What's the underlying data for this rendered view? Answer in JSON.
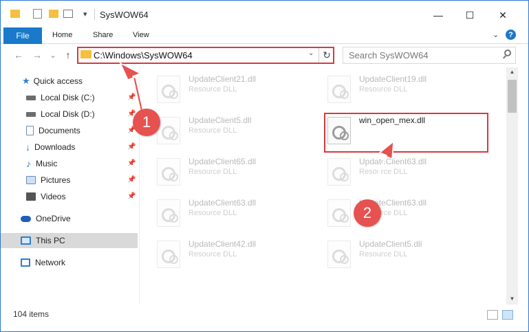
{
  "window": {
    "title": "SysWOW64",
    "minimize_glyph": "—",
    "maximize_glyph": "☐",
    "close_glyph": "✕",
    "qat_dropdown_glyph": "▾"
  },
  "ribbon": {
    "tabs": [
      "File",
      "Home",
      "Share",
      "View"
    ],
    "help_glyph": "?"
  },
  "nav": {
    "back_glyph": "←",
    "forward_glyph": "→",
    "recent_glyph": "⌄",
    "up_glyph": "↑",
    "path": "C:\\Windows\\SysWOW64",
    "path_dropdown_glyph": "⌄",
    "refresh_glyph": "↻",
    "search_placeholder": "Search SysWOW64"
  },
  "sidebar": {
    "pin_glyph": "📌",
    "items": [
      {
        "label": "Quick access",
        "icon": "star-icon",
        "color": "#2d7dd2"
      },
      {
        "label": "Local Disk (C:)",
        "icon": "drive-icon",
        "color": "#6d6d6d"
      },
      {
        "label": "Local Disk (D:)",
        "icon": "drive-icon",
        "color": "#6d6d6d"
      },
      {
        "label": "Documents",
        "icon": "documents-icon",
        "color": "#6a8bb8"
      },
      {
        "label": "Downloads",
        "icon": "downloads-icon",
        "color": "#2d7dd2"
      },
      {
        "label": "Music",
        "icon": "music-icon",
        "color": "#2d7dd2"
      },
      {
        "label": "Pictures",
        "icon": "pictures-icon",
        "color": "#6a8bb8"
      },
      {
        "label": "Videos",
        "icon": "videos-icon",
        "color": "#555555"
      },
      {
        "label": "OneDrive",
        "icon": "cloud-icon",
        "color": "#1f5fb8"
      },
      {
        "label": "This PC",
        "icon": "computer-icon",
        "color": "#2d7dd2"
      },
      {
        "label": "Network",
        "icon": "network-icon",
        "color": "#2d7dd2"
      }
    ]
  },
  "files": [
    {
      "name": "UpdateClient21.dll",
      "type": "Resource DLL"
    },
    {
      "name": "UpdateClient19.dll",
      "type": "Resource DLL"
    },
    {
      "name": "UpdateClient5.dll",
      "type": "Resource DLL"
    },
    {
      "name": "win_open_mex.dll",
      "type": ""
    },
    {
      "name": "UpdateClient65.dll",
      "type": "Resource DLL"
    },
    {
      "name": "UpdateClient63.dll",
      "type": "Resource DLL"
    },
    {
      "name": "UpdateClient63.dll",
      "type": "Resource DLL"
    },
    {
      "name": "UpdateClient63.dll",
      "type": "Resource DLL"
    },
    {
      "name": "UpdateClient42.dll",
      "type": "Resource DLL"
    },
    {
      "name": "UpdateClient5.dll",
      "type": "Resource DLL"
    }
  ],
  "status": {
    "item_count": "104 items"
  },
  "annotations": {
    "step1": "1",
    "step2": "2",
    "accent": "#e5524f"
  },
  "scrollbar": {
    "up_glyph": "▲",
    "down_glyph": "▼"
  }
}
